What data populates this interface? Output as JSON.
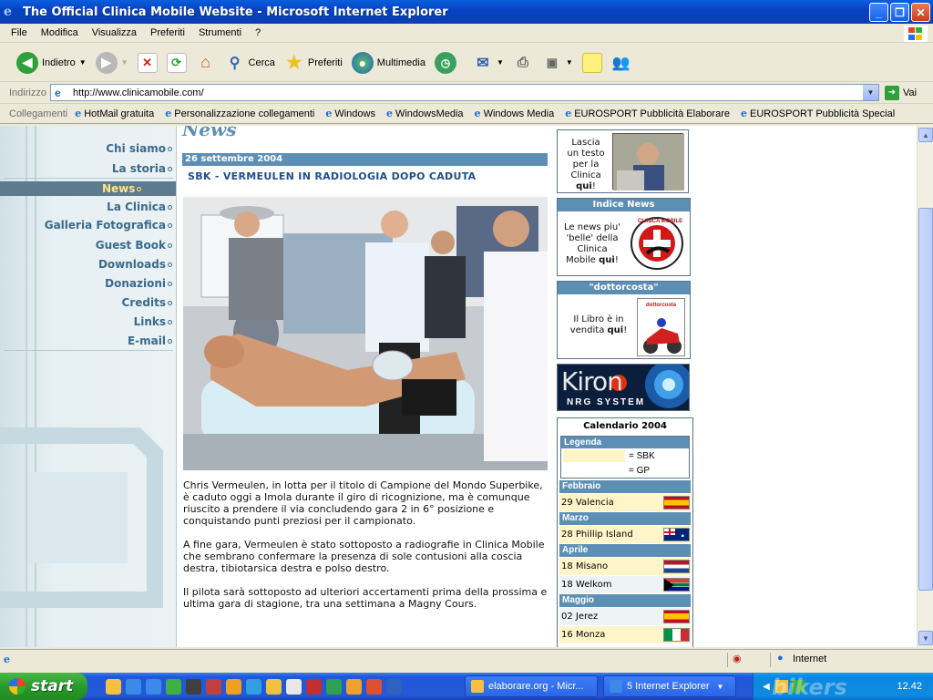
{
  "window": {
    "title": "The Official Clinica Mobile Website - Microsoft Internet Explorer",
    "minimize": "_",
    "maximize": "❐",
    "close": "✕"
  },
  "menu": [
    "File",
    "Modifica",
    "Visualizza",
    "Preferiti",
    "Strumenti",
    "?"
  ],
  "toolbar": {
    "back": "Indietro",
    "search": "Cerca",
    "favorites": "Preferiti",
    "media": "Multimedia"
  },
  "address": {
    "label": "Indirizzo",
    "url": "http://www.clinicamobile.com/",
    "go": "Vai"
  },
  "links": {
    "label": "Collegamenti",
    "items": [
      "HotMail gratuita",
      "Personalizzazione collegamenti",
      "Windows",
      "WindowsMedia",
      "Windows Media",
      "EUROSPORT Pubblicità Elaborare",
      "EUROSPORT Pubblicità Special"
    ]
  },
  "sitenav": {
    "items": [
      "Chi siamo",
      "La storia",
      "News",
      "La Clinica",
      "Galleria Fotografica",
      "Guest Book",
      "Downloads",
      "Donazioni",
      "Credits",
      "Links",
      "E-mail"
    ],
    "active_index": 2
  },
  "article": {
    "section": "News",
    "date": "26 settembre 2004",
    "headline": "SBK - VERMEULEN IN RADIOLOGIA DOPO CADUTA",
    "paragraphs": [
      "Chris Vermeulen, in lotta per il titolo di Campione del Mondo Superbike, è caduto oggi a Imola durante il giro di ricognizione, ma è comunque riuscito a prendere il via concludendo gara 2 in 6° posizione e conquistando punti preziosi per il campionato.",
      "A fine gara, Vermeulen è stato sottoposto a radiografie in Clinica Mobile che sembrano confermare la presenza di sole contusioni alla coscia destra, tibiotarsica destra e polso destro.",
      "Il pilota sarà sottoposto ad ulteriori accertamenti prima della prossima e ultima gara di stagione, tra una settimana a Magny Cours."
    ]
  },
  "sidebar": {
    "guest": {
      "line1": "Lascia",
      "line2": "un testo",
      "line3": "per la",
      "line4": "Clinica",
      "link": "qui",
      "suffix": "!"
    },
    "news_index": {
      "title": "Indice News",
      "line1": "Le news piu'",
      "line2": "'belle' della",
      "line3": "Clinica",
      "line4": "Mobile",
      "link": "qui",
      "suffix": "!",
      "logo_text": "CLINICA MOBILE"
    },
    "book": {
      "title": "\"dottorcosta\"",
      "line1": "Il Libro è in",
      "line2": "vendita",
      "link": "qui",
      "suffix": "!",
      "cover_text": "dottorcosta"
    },
    "kiron": {
      "brand": "Kiron",
      "sub": "NRG SYSTEM"
    }
  },
  "calendar": {
    "title": "Calendario 2004",
    "legend_title": "Legenda",
    "legend": [
      {
        "label": "= SBK",
        "color": "#fff5c8"
      },
      {
        "label": "= GP",
        "color": "#ffffff"
      }
    ],
    "months": [
      {
        "name": "Febbraio",
        "races": [
          {
            "text": "29 Valencia",
            "type": "sbk",
            "flag": "spain"
          }
        ]
      },
      {
        "name": "Marzo",
        "races": [
          {
            "text": "28 Phillip Island",
            "type": "sbk",
            "flag": "australia"
          }
        ]
      },
      {
        "name": "Aprile",
        "races": [
          {
            "text": "18 Misano",
            "type": "sbk",
            "flag": "netherlands"
          },
          {
            "text": "18 Welkom",
            "type": "gp",
            "flag": "south-africa"
          }
        ]
      },
      {
        "name": "Maggio",
        "races": [
          {
            "text": "02 Jerez",
            "type": "gp",
            "flag": "spain"
          },
          {
            "text": "16 Monza",
            "type": "sbk",
            "flag": "italy"
          }
        ]
      }
    ]
  },
  "status": {
    "zone": "Internet"
  },
  "taskbar": {
    "start": "start",
    "tasks": [
      "elaborare.org - Micr...",
      "5 Internet Explorer"
    ],
    "watermark": "bikers",
    "clock": "12.42"
  }
}
